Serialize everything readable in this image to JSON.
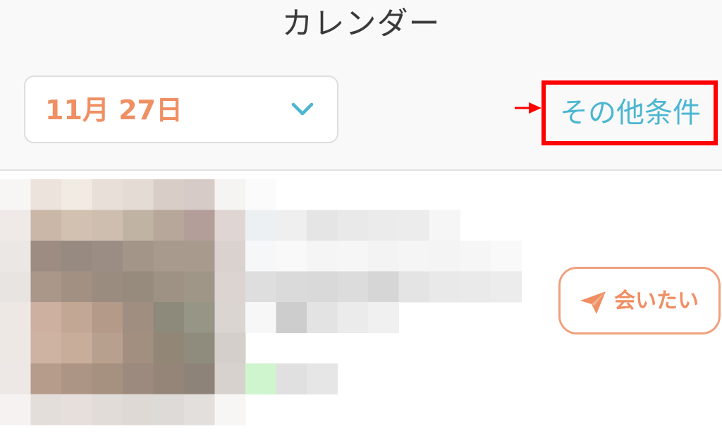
{
  "header": {
    "title": "カレンダー"
  },
  "filters": {
    "date_value": "11月 27日",
    "date_icon": "chevron-down-icon",
    "other_conditions_label": "その他条件"
  },
  "annotation": {
    "highlight_color": "#ff0000"
  },
  "list": {
    "rows": [
      {
        "meet_button_label": "会いたい",
        "meet_icon": "send-icon"
      }
    ]
  },
  "colors": {
    "accent_orange": "#ef8f63",
    "link_blue": "#4bb6d1"
  }
}
